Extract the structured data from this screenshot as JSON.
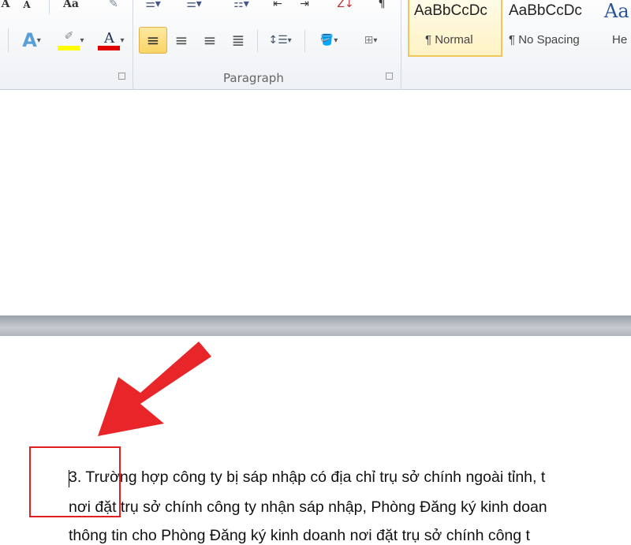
{
  "ribbon": {
    "font_group": {
      "buttons": [
        "A",
        "A",
        "Aa"
      ],
      "text_effects_icon": "text-effects-icon",
      "highlight_color": "#ffff00",
      "font_color": "#e00000"
    },
    "paragraph_group": {
      "label": "Paragraph",
      "active_alignment": "align-left"
    },
    "styles": [
      {
        "preview": "AaBbCcDc",
        "name": "¶ Normal",
        "selected": true
      },
      {
        "preview": "AaBbCcDc",
        "name": "¶ No Spacing"
      },
      {
        "preview": "Aa",
        "name": "He"
      }
    ]
  },
  "document": {
    "lines": [
      "3. Trường hợp công ty bị sáp nhập có địa chỉ trụ sở chính ngoài tỉnh, t",
      "nơi đặt trụ sở chính công ty nhận sáp nhập, Phòng Đăng ký kinh doan",
      "thông tin cho Phòng Đăng ký kinh doanh nơi đặt trụ sở chính công t"
    ]
  },
  "annotation": {
    "arrow_color": "#e8262a",
    "box_color": "#e02020"
  }
}
